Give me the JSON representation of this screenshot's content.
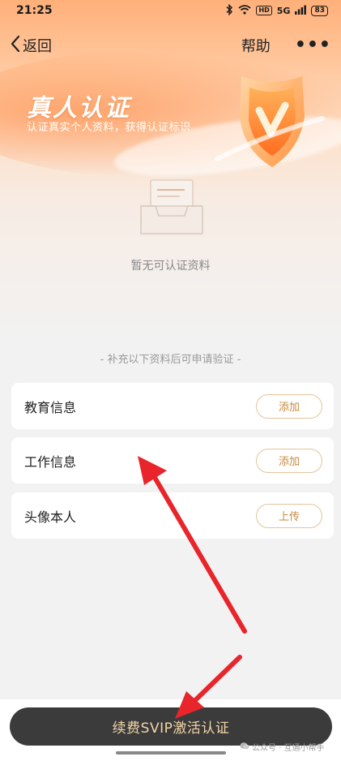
{
  "status_bar": {
    "time": "21:25",
    "hd_label": "HD",
    "network_label": "5G",
    "battery": "83"
  },
  "nav": {
    "back_label": "返回",
    "help_label": "帮助",
    "more_label": "•••"
  },
  "hero": {
    "title": "真人认证",
    "subtitle": "认证真实个人资料，获得认证标识"
  },
  "empty_state": {
    "text": "暂无可认证资料"
  },
  "hint": "- 补充以下资料后可申请验证 -",
  "items": [
    {
      "label": "教育信息",
      "action": "添加"
    },
    {
      "label": "工作信息",
      "action": "添加"
    },
    {
      "label": "头像本人",
      "action": "上传"
    }
  ],
  "cta_label": "续费SVIP激活认证",
  "watermark": "公众号 · 互通小帮手",
  "colors": {
    "accent_orange": "#ff8a3d",
    "button_border": "#e3c49a",
    "button_text": "#c68a3e",
    "cta_bg": "#3b3b3b",
    "cta_text": "#f3d6a7",
    "annotation_arrow": "#e8252b"
  }
}
